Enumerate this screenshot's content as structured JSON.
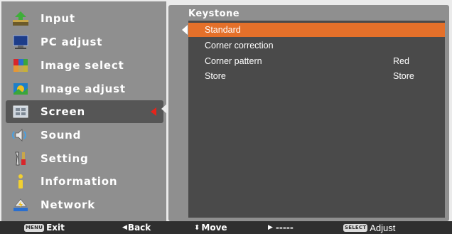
{
  "menu": {
    "items": [
      {
        "label": "Input",
        "icon": "input-icon"
      },
      {
        "label": "PC adjust",
        "icon": "pc-adjust-icon"
      },
      {
        "label": "Image select",
        "icon": "image-select-icon"
      },
      {
        "label": "Image adjust",
        "icon": "image-adjust-icon"
      },
      {
        "label": "Screen",
        "icon": "screen-icon",
        "selected": true
      },
      {
        "label": "Sound",
        "icon": "sound-icon"
      },
      {
        "label": "Setting",
        "icon": "setting-icon"
      },
      {
        "label": "Information",
        "icon": "information-icon"
      },
      {
        "label": "Network",
        "icon": "network-icon"
      }
    ]
  },
  "submenu": {
    "title": "Keystone",
    "rows": [
      {
        "label": "Standard",
        "value": "",
        "selected": true
      },
      {
        "label": "Corner correction",
        "value": ""
      },
      {
        "label": "Corner pattern",
        "value": "Red"
      },
      {
        "label": "Store",
        "value": "Store"
      }
    ]
  },
  "bottom_bar": {
    "exit_key": "MENU",
    "exit_label": "Exit",
    "back_label": "Back",
    "move_label": "Move",
    "next_label": "-----",
    "adjust_key": "SELECT",
    "adjust_label": "Adjust"
  },
  "colors": {
    "panel_bg": "#8f8f8f",
    "inner_bg": "#4a4a4a",
    "highlight": "#e4702a",
    "selected_item_bg": "#565656",
    "arrow_red": "#e6241a",
    "bottom_bar": "#2f2f2f"
  }
}
